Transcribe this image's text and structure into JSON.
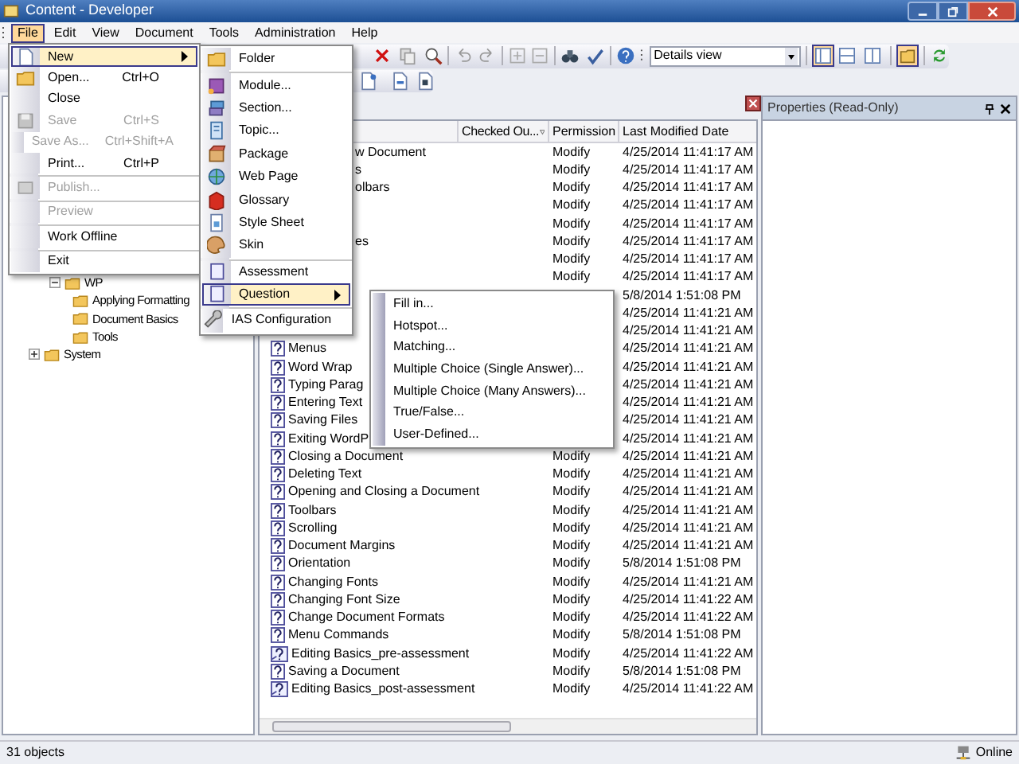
{
  "window": {
    "title": "Content - Developer"
  },
  "menu_bar": [
    {
      "label": "File",
      "selected": true
    },
    {
      "label": "Edit",
      "selected": false
    },
    {
      "label": "View",
      "selected": false
    },
    {
      "label": "Document",
      "selected": false
    },
    {
      "label": "Tools",
      "selected": false
    },
    {
      "label": "Administration",
      "selected": false
    },
    {
      "label": "Help",
      "selected": false
    }
  ],
  "file_menu": [
    {
      "kind": "item",
      "label": "New",
      "submenu": true,
      "selected": true,
      "disabled": false
    },
    {
      "kind": "item",
      "label": "Open...",
      "shortcut": "Ctrl+O",
      "submenu": false,
      "selected": false,
      "disabled": false
    },
    {
      "kind": "item",
      "label": "Close",
      "submenu": false,
      "selected": false,
      "disabled": false
    },
    {
      "kind": "item",
      "label": "Save",
      "shortcut": "Ctrl+S",
      "submenu": false,
      "selected": false,
      "disabled": true
    },
    {
      "kind": "item",
      "label": "Save As...",
      "shortcut": "Ctrl+Shift+A",
      "submenu": false,
      "selected": false,
      "disabled": true
    },
    {
      "kind": "item",
      "label": "Print...",
      "shortcut": "Ctrl+P",
      "submenu": false,
      "selected": false,
      "disabled": false
    },
    {
      "kind": "separator"
    },
    {
      "kind": "item",
      "label": "Publish...",
      "submenu": false,
      "selected": false,
      "disabled": true
    },
    {
      "kind": "separator"
    },
    {
      "kind": "item",
      "label": "Preview",
      "submenu": false,
      "selected": false,
      "disabled": true
    },
    {
      "kind": "separator"
    },
    {
      "kind": "item",
      "label": "Work Offline",
      "submenu": false,
      "selected": false,
      "disabled": false
    },
    {
      "kind": "separator"
    },
    {
      "kind": "item",
      "label": "Exit",
      "submenu": false,
      "selected": false,
      "disabled": false
    }
  ],
  "new_menu": [
    {
      "kind": "item",
      "label": "Folder",
      "submenu": false,
      "selected": false,
      "disabled": false
    },
    {
      "kind": "separator"
    },
    {
      "kind": "item",
      "label": "Module...",
      "submenu": false,
      "selected": false,
      "disabled": false
    },
    {
      "kind": "item",
      "label": "Section...",
      "submenu": false,
      "selected": false,
      "disabled": false
    },
    {
      "kind": "item",
      "label": "Topic...",
      "submenu": false,
      "selected": false,
      "disabled": false
    },
    {
      "kind": "item",
      "label": "Package",
      "submenu": false,
      "selected": false,
      "disabled": false
    },
    {
      "kind": "item",
      "label": "Web Page",
      "submenu": false,
      "selected": false,
      "disabled": false
    },
    {
      "kind": "item",
      "label": "Glossary",
      "submenu": false,
      "selected": false,
      "disabled": false
    },
    {
      "kind": "item",
      "label": "Style Sheet",
      "submenu": false,
      "selected": false,
      "disabled": false
    },
    {
      "kind": "item",
      "label": "Skin",
      "submenu": false,
      "selected": false,
      "disabled": false
    },
    {
      "kind": "separator"
    },
    {
      "kind": "item",
      "label": "Assessment",
      "submenu": false,
      "selected": false,
      "disabled": false
    },
    {
      "kind": "item",
      "label": "Question",
      "submenu": true,
      "selected": true,
      "disabled": false
    },
    {
      "kind": "separator"
    },
    {
      "kind": "item",
      "label": "IAS Configuration",
      "submenu": false,
      "selected": false,
      "disabled": false
    }
  ],
  "question_menu": [
    {
      "kind": "item",
      "label": "Fill in...",
      "submenu": false,
      "selected": false,
      "disabled": false
    },
    {
      "kind": "item",
      "label": "Hotspot...",
      "submenu": false,
      "selected": false,
      "disabled": false
    },
    {
      "kind": "item",
      "label": "Matching...",
      "submenu": false,
      "selected": false,
      "disabled": false
    },
    {
      "kind": "item",
      "label": "Multiple Choice (Single Answer)...",
      "submenu": false,
      "selected": false,
      "disabled": false
    },
    {
      "kind": "item",
      "label": "Multiple Choice (Many Answers)...",
      "submenu": false,
      "selected": false,
      "disabled": false
    },
    {
      "kind": "item",
      "label": "True/False...",
      "submenu": false,
      "selected": false,
      "disabled": false
    },
    {
      "kind": "item",
      "label": "User-Defined...",
      "submenu": false,
      "selected": false,
      "disabled": false
    }
  ],
  "toolbar": {
    "view_select": "Details view",
    "view_buttons": [
      {
        "selected": true
      },
      {
        "selected": false
      },
      {
        "selected": false
      }
    ],
    "properties_button": {
      "selected": true
    }
  },
  "tree": [
    {
      "label": "WP",
      "expanded": true,
      "children": [
        {
          "label": "Applying Formatting"
        },
        {
          "label": "Document Basics"
        },
        {
          "label": "Tools"
        }
      ]
    },
    {
      "label": "System",
      "expanded": false
    }
  ],
  "list": {
    "columns": [
      "Checked Ou...",
      "Permission",
      "Last Modified Date"
    ],
    "rows": [
      {
        "name": "w Document",
        "covered": true,
        "permission": "Modify",
        "date": "4/25/2014 11:41:17 AM"
      },
      {
        "name": "s",
        "covered": true,
        "permission": "Modify",
        "date": "4/25/2014 11:41:17 AM"
      },
      {
        "name": "olbars",
        "covered": true,
        "permission": "Modify",
        "date": "4/25/2014 11:41:17 AM"
      },
      {
        "permission": "Modify",
        "date": "4/25/2014 11:41:17 AM"
      },
      {
        "permission": "Modify",
        "date": "4/25/2014 11:41:17 AM"
      },
      {
        "name": "es",
        "covered": true,
        "permission": "Modify",
        "date": "4/25/2014 11:41:17 AM"
      },
      {
        "permission": "Modify",
        "date": "4/25/2014 11:41:17 AM"
      },
      {
        "permission": "Modify",
        "date": "4/25/2014 11:41:17 AM"
      },
      {
        "date": "5/8/2014 1:51:08 PM"
      },
      {
        "date": "4/25/2014 11:41:21 AM"
      },
      {
        "date": "4/25/2014 11:41:21 AM"
      },
      {
        "kind": "question",
        "name": "Menus",
        "date": "4/25/2014 11:41:21 AM"
      },
      {
        "kind": "question",
        "name": "Word Wrap",
        "date": "4/25/2014 11:41:21 AM"
      },
      {
        "kind": "question",
        "name": "Typing Parag",
        "date": "4/25/2014 11:41:21 AM"
      },
      {
        "kind": "question",
        "name": "Entering Text",
        "date": "4/25/2014 11:41:21 AM"
      },
      {
        "kind": "question",
        "name": "Saving Files",
        "date": "4/25/2014 11:41:21 AM"
      },
      {
        "kind": "question",
        "name": "Exiting WordP",
        "date": "4/25/2014 11:41:21 AM"
      },
      {
        "kind": "question",
        "name": "Closing a Document",
        "permission": "Modify",
        "date": "4/25/2014 11:41:21 AM"
      },
      {
        "kind": "question",
        "name": "Deleting Text",
        "permission": "Modify",
        "date": "4/25/2014 11:41:21 AM"
      },
      {
        "kind": "question",
        "name": "Opening and Closing a Document",
        "permission": "Modify",
        "date": "4/25/2014 11:41:21 AM"
      },
      {
        "kind": "question",
        "name": "Toolbars",
        "permission": "Modify",
        "date": "4/25/2014 11:41:21 AM"
      },
      {
        "kind": "question",
        "name": "Scrolling",
        "permission": "Modify",
        "date": "4/25/2014 11:41:21 AM"
      },
      {
        "kind": "question",
        "name": "Document Margins",
        "permission": "Modify",
        "date": "4/25/2014 11:41:21 AM"
      },
      {
        "kind": "question",
        "name": "Orientation",
        "permission": "Modify",
        "date": "5/8/2014 1:51:08 PM"
      },
      {
        "kind": "question",
        "name": "Changing Fonts",
        "permission": "Modify",
        "date": "4/25/2014 11:41:21 AM"
      },
      {
        "kind": "question",
        "name": "Changing Font Size",
        "permission": "Modify",
        "date": "4/25/2014 11:41:22 AM"
      },
      {
        "kind": "question",
        "name": "Change Document Formats",
        "permission": "Modify",
        "date": "4/25/2014 11:41:22 AM"
      },
      {
        "kind": "question",
        "name": "Menu Commands",
        "permission": "Modify",
        "date": "5/8/2014 1:51:08 PM"
      },
      {
        "kind": "assessment",
        "name": "Editing Basics_pre-assessment",
        "permission": "Modify",
        "date": "4/25/2014 11:41:22 AM"
      },
      {
        "kind": "question",
        "name": "Saving a Document",
        "permission": "Modify",
        "date": "5/8/2014 1:51:08 PM"
      },
      {
        "kind": "assessment",
        "name": "Editing Basics_post-assessment",
        "permission": "Modify",
        "date": "4/25/2014 11:41:22 AM"
      }
    ]
  },
  "properties": {
    "title": "Properties (Read-Only)"
  },
  "status_bar": {
    "count": "31 objects",
    "connection": "Online"
  }
}
